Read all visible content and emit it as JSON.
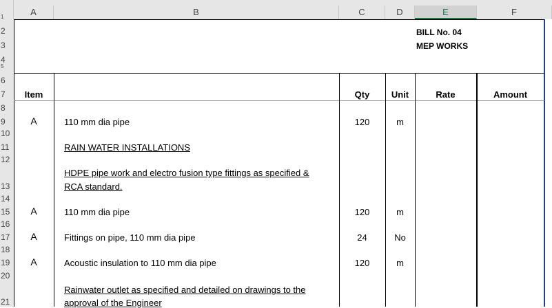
{
  "columns": [
    "A",
    "B",
    "C",
    "D",
    "E",
    "F"
  ],
  "rows": [
    "1",
    "2",
    "3",
    "4",
    "5",
    "6",
    "7",
    "8",
    "9",
    "10",
    "11",
    "12",
    "13",
    "14",
    "15",
    "16",
    "17",
    "18",
    "19",
    "20",
    "21"
  ],
  "header": {
    "bill_no": "BILL No. 04",
    "section": "MEP WORKS",
    "item": "Item",
    "qty": "Qty",
    "unit": "Unit",
    "rate": "Rate",
    "amount": "Amount"
  },
  "lines": [
    {
      "item": "A",
      "desc": "110 mm dia pipe",
      "qty": "120",
      "unit": "m"
    },
    {
      "heading": "RAIN WATER INSTALLATIONS"
    },
    {
      "desc_line1": "HDPE pipe work and electro fusion type fittings as specified &",
      "desc_line2": "RCA standard."
    },
    {
      "item": "A",
      "desc": "110 mm dia pipe",
      "qty": "120",
      "unit": "m"
    },
    {
      "item": "A",
      "desc": "Fittings on pipe, 110 mm dia pipe",
      "qty": "24",
      "unit": "No"
    },
    {
      "item": "A",
      "desc": "Acoustic insulation to 110 mm dia pipe",
      "qty": "120",
      "unit": "m"
    },
    {
      "desc_line1": "Rainwater outlet as specified and detailed on drawings to the",
      "desc_line2": "approval of the Engineer"
    }
  ]
}
